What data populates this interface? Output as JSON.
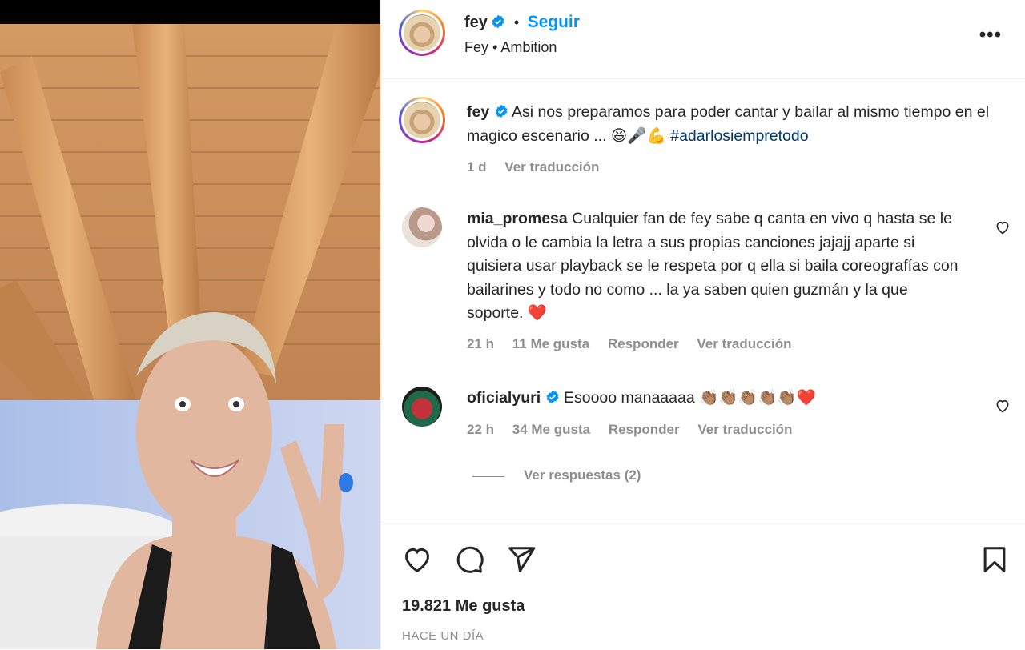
{
  "post": {
    "username": "fey",
    "follow_label": "Seguir",
    "subtitle": "Fey • Ambition",
    "more_label": "•••",
    "likes": "19.821 Me gusta",
    "date": "HACE UN DÍA"
  },
  "caption": {
    "username": "fey",
    "text": "Asi nos preparamos para poder cantar y bailar al mismo tiempo en el magico escenario ... 😆🎤💪",
    "hashtag": "#adarlosiempretodo",
    "time": "1 d",
    "translate": "Ver traducción"
  },
  "comments": [
    {
      "username": "mia_promesa",
      "text": "Cualquier fan de fey sabe q canta en vivo q hasta se le olvida o le cambia la letra a sus propias canciones jajajj aparte si quisiera usar playback se le respeta por q ella si baila coreografías con bailarines y todo no como ... la ya saben quien guzmán y la que soporte. ❤️",
      "time": "21 h",
      "likes": "11 Me gusta",
      "reply": "Responder",
      "translate": "Ver traducción"
    },
    {
      "username": "oficialyuri",
      "text": "Esoooo manaaaaa 👏🏽👏🏽👏🏽👏🏽👏🏽❤️",
      "time": "22 h",
      "likes": "34 Me gusta",
      "reply": "Responder",
      "translate": "Ver traducción",
      "view_replies": "Ver respuestas (2)"
    }
  ],
  "colors": {
    "accent": "#0095f6",
    "text": "#262626",
    "muted": "#8e8e8e",
    "hashtag": "#00376b"
  },
  "icons": [
    "heart-icon",
    "comment-icon",
    "share-icon",
    "bookmark-icon",
    "verified-icon",
    "more-icon"
  ]
}
